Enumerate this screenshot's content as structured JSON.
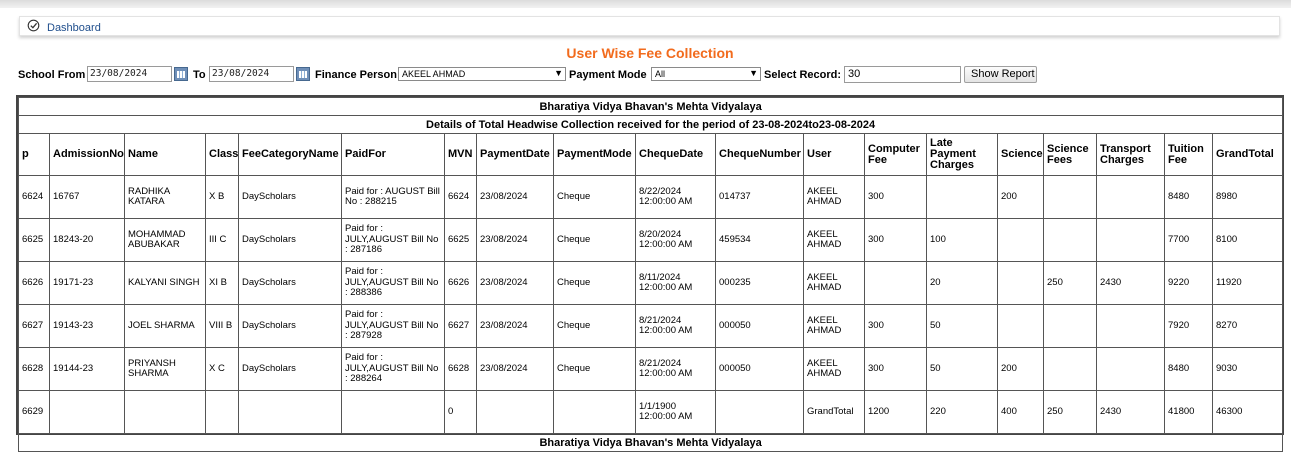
{
  "dashboard": {
    "link_label": "Dashboard"
  },
  "page_title": "User Wise Fee Collection",
  "filters": {
    "school_from_label": "School From",
    "from_date": "23/08/2024",
    "to_label": "To",
    "to_date": "23/08/2024",
    "finance_person_label": "Finance Person",
    "finance_person_value": "AKEEL AHMAD",
    "payment_mode_label": "Payment Mode",
    "payment_mode_value": "All",
    "select_record_label": "Select Record:",
    "select_record_value": "30",
    "show_report_label": "Show Report"
  },
  "report": {
    "school_name": "Bharatiya Vidya Bhavan's Mehta Vidyalaya",
    "period_title": "Details of Total Headwise Collection received for the period of 23-08-2024to23-08-2024",
    "columns": [
      "p",
      "AdmissionNo",
      "Name",
      "Class",
      "FeeCategoryName",
      "PaidFor",
      "MVN",
      "PaymentDate",
      "PaymentMode",
      "ChequeDate",
      "ChequeNumber",
      "User",
      "Computer Fee",
      "Late Payment Charges",
      "Science",
      "Science Fees",
      "Transport Charges",
      "Tuition Fee",
      "GrandTotal"
    ],
    "rows": [
      [
        "6624",
        "16767",
        "RADHIKA KATARA",
        "X B",
        "DayScholars",
        "Paid for : AUGUST Bill No : 288215",
        "6624",
        "23/08/2024",
        "Cheque",
        "8/22/2024 12:00:00 AM",
        "014737",
        "AKEEL AHMAD",
        "300",
        "",
        "200",
        "",
        "",
        "8480",
        "8980"
      ],
      [
        "6625",
        "18243-20",
        "MOHAMMAD ABUBAKAR",
        "III C",
        "DayScholars",
        "Paid for : JULY,AUGUST Bill No : 287186",
        "6625",
        "23/08/2024",
        "Cheque",
        "8/20/2024 12:00:00 AM",
        "459534",
        "AKEEL AHMAD",
        "300",
        "100",
        "",
        "",
        "",
        "7700",
        "8100"
      ],
      [
        "6626",
        "19171-23",
        "KALYANI SINGH",
        "XI B",
        "DayScholars",
        "Paid for : JULY,AUGUST Bill No : 288386",
        "6626",
        "23/08/2024",
        "Cheque",
        "8/11/2024 12:00:00 AM",
        "000235",
        "AKEEL AHMAD",
        "",
        "20",
        "",
        "250",
        "2430",
        "9220",
        "11920"
      ],
      [
        "6627",
        "19143-23",
        "JOEL SHARMA",
        "VIII B",
        "DayScholars",
        "Paid for : JULY,AUGUST Bill No : 287928",
        "6627",
        "23/08/2024",
        "Cheque",
        "8/21/2024 12:00:00 AM",
        "000050",
        "AKEEL AHMAD",
        "300",
        "50",
        "",
        "",
        "",
        "7920",
        "8270"
      ],
      [
        "6628",
        "19144-23",
        "PRIYANSH SHARMA",
        "X C",
        "DayScholars",
        "Paid for : JULY,AUGUST Bill No : 288264",
        "6628",
        "23/08/2024",
        "Cheque",
        "8/21/2024 12:00:00 AM",
        "000050",
        "AKEEL AHMAD",
        "300",
        "50",
        "200",
        "",
        "",
        "8480",
        "9030"
      ],
      [
        "6629",
        "",
        "",
        "",
        "",
        "",
        "0",
        "",
        "",
        "1/1/1900 12:00:00 AM",
        "",
        "GrandTotal",
        "1200",
        "220",
        "400",
        "250",
        "2430",
        "41800",
        "46300"
      ]
    ],
    "next_school_name": "Bharatiya Vidya Bhavan's Mehta Vidyalaya"
  }
}
